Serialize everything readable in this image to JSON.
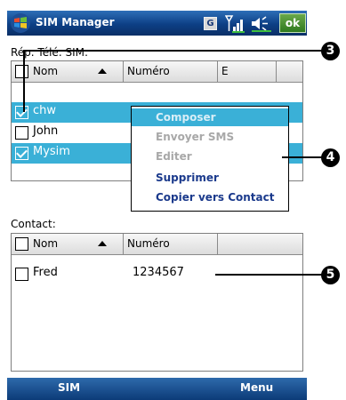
{
  "titlebar": {
    "title": "SIM Manager",
    "g_label": "G",
    "ok_label": "ok"
  },
  "sim_section": {
    "label": "Rép. Télé. SIM:",
    "headers": {
      "name": "Nom",
      "number": "Numéro",
      "extra": "E"
    },
    "rows": [
      {
        "name": "chw",
        "checked": true,
        "selected": true
      },
      {
        "name": "John",
        "checked": false,
        "selected": false
      },
      {
        "name": "Mysim",
        "checked": true,
        "selected": true
      }
    ]
  },
  "context_menu": {
    "items": [
      {
        "label": "Composer",
        "state": "disabled-highlight"
      },
      {
        "label": "Envoyer SMS",
        "state": "disabled"
      },
      {
        "label": "Editer",
        "state": "disabled"
      },
      {
        "label": "Supprimer",
        "state": "enabled"
      },
      {
        "label": "Copier vers Contact",
        "state": "enabled"
      }
    ]
  },
  "contact_section": {
    "label": "Contact:",
    "headers": {
      "name": "Nom",
      "number": "Numéro"
    },
    "rows": [
      {
        "name": "Fred",
        "number": "1234567",
        "checked": false
      }
    ]
  },
  "softkeys": {
    "left": "SIM",
    "right": "Menu"
  },
  "callouts": [
    "3",
    "4",
    "5"
  ],
  "colors": {
    "titlebar": "#0d3f85",
    "selection": "#3ab0d7",
    "menu_text": "#1b3a8c",
    "ok_button": "#2f7a1e"
  }
}
